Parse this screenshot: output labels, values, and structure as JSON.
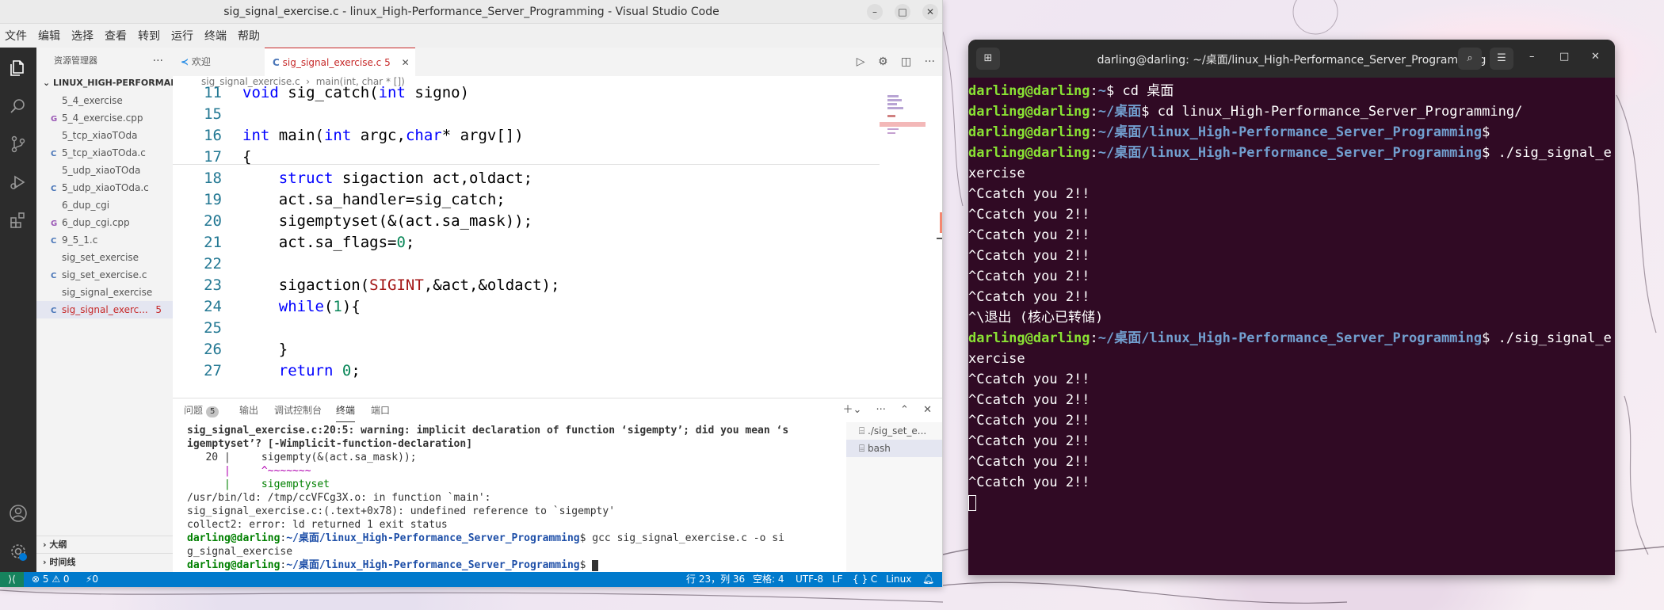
{
  "vscode": {
    "title": "sig_signal_exercise.c - linux_High-Performance_Server_Programming - Visual Studio Code",
    "menu": [
      "文件",
      "编辑",
      "选择",
      "查看",
      "转到",
      "运行",
      "终端",
      "帮助"
    ],
    "sidebar": {
      "header": "资源管理器",
      "folder": "LINUX_HIGH-PERFORMAN...",
      "files": [
        {
          "name": "5_4_exercise",
          "icon": ""
        },
        {
          "name": "5_4_exercise.cpp",
          "icon": "G"
        },
        {
          "name": "5_tcp_xiaoTOda",
          "icon": ""
        },
        {
          "name": "5_tcp_xiaoTOda.c",
          "icon": "C"
        },
        {
          "name": "5_udp_xiaoTOda",
          "icon": ""
        },
        {
          "name": "5_udp_xiaoTOda.c",
          "icon": "C"
        },
        {
          "name": "6_dup_cgi",
          "icon": ""
        },
        {
          "name": "6_dup_cgi.cpp",
          "icon": "G"
        },
        {
          "name": "9_5_1.c",
          "icon": "C"
        },
        {
          "name": "sig_set_exercise",
          "icon": ""
        },
        {
          "name": "sig_set_exercise.c",
          "icon": "C"
        },
        {
          "name": "sig_signal_exercise",
          "icon": ""
        },
        {
          "name": "sig_signal_exerc...",
          "icon": "C",
          "badge": "5"
        }
      ],
      "outline": "大纲",
      "timeline": "时间线"
    },
    "tabs": {
      "welcome": "欢迎",
      "active": "sig_signal_exercise.c",
      "active_badge": "5"
    },
    "breadcrumb": {
      "file": "sig_signal_exercise.c",
      "symbol": "main(int, char * [])"
    },
    "code": [
      {
        "n": "11",
        "text": "void sig_catch(int signo)"
      },
      {
        "n": "15",
        "text": ""
      },
      {
        "n": "16",
        "text": "int main(int argc,char* argv[])"
      },
      {
        "n": "17",
        "text": "{"
      },
      {
        "n": "18",
        "text": "    struct sigaction act,oldact;"
      },
      {
        "n": "19",
        "text": "    act.sa_handler=sig_catch;"
      },
      {
        "n": "20",
        "text": "    sigemptyset(&(act.sa_mask));"
      },
      {
        "n": "21",
        "text": "    act.sa_flags=0;"
      },
      {
        "n": "22",
        "text": ""
      },
      {
        "n": "23",
        "text": "    sigaction(SIGINT,&act,&oldact);"
      },
      {
        "n": "24",
        "text": "    while(1){"
      },
      {
        "n": "25",
        "text": ""
      },
      {
        "n": "26",
        "text": "    }"
      },
      {
        "n": "27",
        "text": "    return 0;"
      }
    ],
    "panel": {
      "tabs": [
        "问题",
        "输出",
        "调试控制台",
        "终端",
        "端口"
      ],
      "problems_count": "5",
      "terminal_lines": [
        "sig_signal_exercise.c:20:5: warning: implicit declaration of function ‘sigempty’; did you mean ‘s",
        "igemptyset’? [-Wimplicit-function-declaration]",
        "   20 |     sigempty(&(act.sa_mask));",
        "      |     ^~~~~~~~",
        "      |     sigemptyset",
        "/usr/bin/ld: /tmp/ccVFCg3X.o: in function `main':",
        "sig_signal_exercise.c:(.text+0x78): undefined reference to `sigempty'",
        "collect2: error: ld returned 1 exit status",
        "gcc sig_signal_exercise.c -o si",
        "g_signal_exercise",
        ""
      ],
      "prompt_user": "darling@darling",
      "prompt_path": "~/桌面/linux_High-Performance_Server_Programming",
      "term_list": [
        "./sig_set_e...",
        "bash"
      ]
    },
    "status": {
      "errors": "⊗ 5 ⚠ 0",
      "ports": "⚡0",
      "position": "行 23，列 36",
      "spaces": "空格: 4",
      "encoding": "UTF-8",
      "eol": "LF",
      "language": "{ } C",
      "platform": "Linux"
    }
  },
  "terminal": {
    "title": "darling@darling: ~/桌面/linux_High-Performance_Server_Programming",
    "user": "darling@darling",
    "lines": [
      {
        "path": "~",
        "cmd": "$ cd 桌面"
      },
      {
        "path": "~/桌面",
        "cmd": "$ cd linux_High-Performance_Server_Programming/"
      },
      {
        "path": "~/桌面/linux_High-Performance_Server_Programming",
        "cmd": "$"
      },
      {
        "path": "~/桌面/linux_High-Performance_Server_Programming",
        "cmd": "$ ./sig_signal_e"
      },
      {
        "text": "xercise"
      },
      {
        "text": "^Ccatch you 2!!"
      },
      {
        "text": "^Ccatch you 2!!"
      },
      {
        "text": "^Ccatch you 2!!"
      },
      {
        "text": "^Ccatch you 2!!"
      },
      {
        "text": "^Ccatch you 2!!"
      },
      {
        "text": "^Ccatch you 2!!"
      },
      {
        "text": "^\\退出 (核心已转储)"
      },
      {
        "path": "~/桌面/linux_High-Performance_Server_Programming",
        "cmd": "$ ./sig_signal_e"
      },
      {
        "text": "xercise"
      },
      {
        "text": "^Ccatch you 2!!"
      },
      {
        "text": "^Ccatch you 2!!"
      },
      {
        "text": "^Ccatch you 2!!"
      },
      {
        "text": "^Ccatch you 2!!"
      },
      {
        "text": "^Ccatch you 2!!"
      },
      {
        "text": "^Ccatch you 2!!"
      }
    ]
  },
  "colors": {
    "statusbar": "#007acc",
    "terminal_bg": "#300a24",
    "prompt_user": "#8ae234",
    "prompt_path": "#729fcf"
  }
}
